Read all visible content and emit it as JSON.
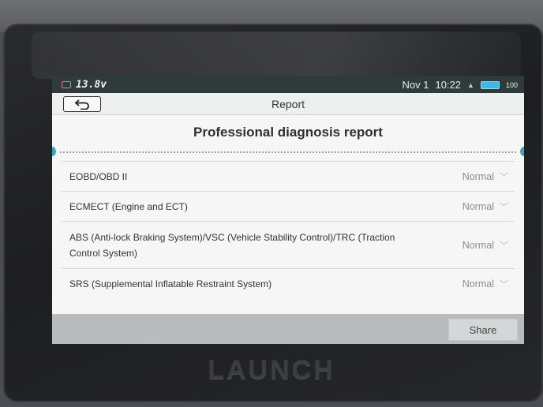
{
  "status_bar": {
    "voltage": "13.8v",
    "date": "Nov 1",
    "time": "10:22",
    "battery": "100"
  },
  "header": {
    "title": "Report"
  },
  "report": {
    "title": "Professional diagnosis report",
    "systems": [
      {
        "name": "EOBD/OBD II",
        "status": "Normal"
      },
      {
        "name": "ECMECT (Engine and ECT)",
        "status": "Normal"
      },
      {
        "name": "ABS (Anti-lock Braking System)/VSC (Vehicle Stability Control)/TRC (Traction Control System)",
        "status": "Normal"
      },
      {
        "name": "SRS (Supplemental Inflatable Restraint System)",
        "status": "Normal"
      }
    ]
  },
  "footer": {
    "share_label": "Share"
  },
  "device": {
    "brand": "LAUNCH"
  },
  "colors": {
    "accent": "#3aa5b8",
    "battery": "#3fb8e8"
  }
}
